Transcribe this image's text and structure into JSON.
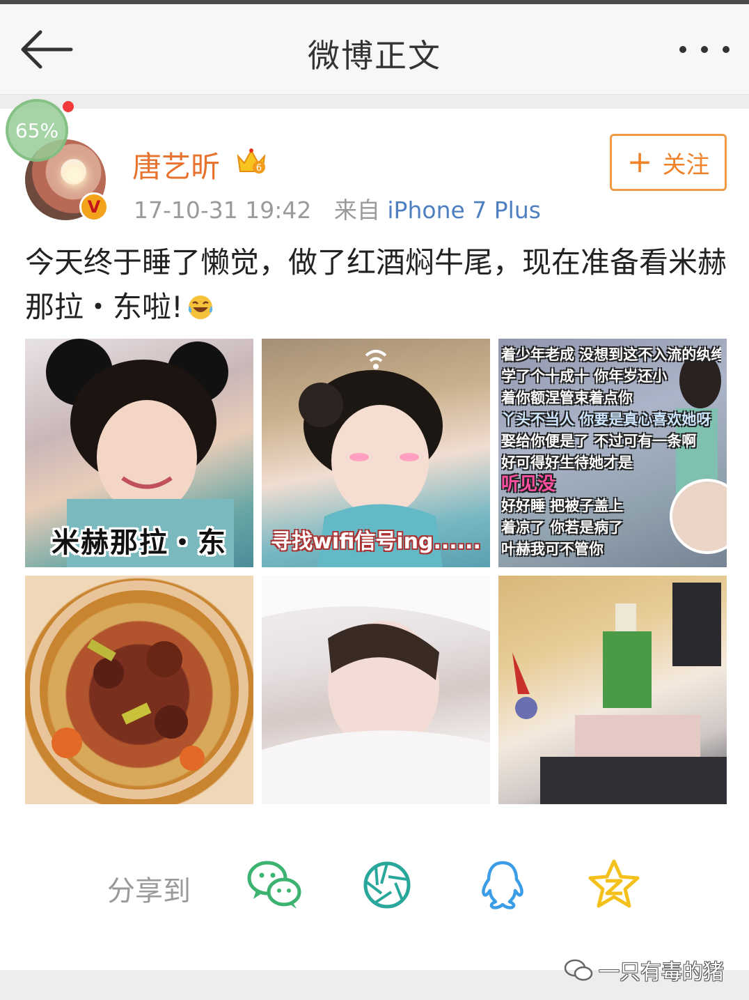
{
  "navbar": {
    "title": "微博正文"
  },
  "overlay": {
    "progress_label": "65%"
  },
  "author": {
    "name": "唐艺昕",
    "timestamp": "17-10-31 19:42",
    "source_prefix": "来自",
    "source_device": "iPhone 7 Plus",
    "verified_mark": "V",
    "crown_level": "6"
  },
  "follow": {
    "plus": "+",
    "label": "关注"
  },
  "post": {
    "text": "今天终于睡了懒觉，做了红酒焖牛尾，现在准备看米赫那拉・东啦!"
  },
  "photos": [
    {
      "caption": "米赫那拉・东"
    },
    {
      "caption": "寻找wifi信号ing......"
    },
    {
      "lines": [
        "着少年老成 没想到这不入流的纨绔",
        "学了个十成十 你年岁还小",
        "着你额涅管束着点你",
        "丫头不当人 你要是真心喜欢她呀",
        "娶给你便是了 不过可有一条啊",
        "好可得好生待她才是",
        "听见没",
        "好好睡 把被子盖上",
        "着凉了 你若是病了",
        "叶赫我可不管你"
      ]
    },
    {},
    {},
    {}
  ],
  "share": {
    "label": "分享到",
    "targets": [
      "wechat-icon",
      "moments-icon",
      "qq-icon",
      "qzone-icon"
    ]
  },
  "watermark": {
    "text": "一只有毒的猪"
  },
  "colors": {
    "username": "#e8732f",
    "device": "#4d7fc1",
    "follow": "#f0832a",
    "wechat": "#3cb371",
    "moments": "#2aa79b",
    "qq": "#3b9de6",
    "qzone": "#f4c11c"
  }
}
